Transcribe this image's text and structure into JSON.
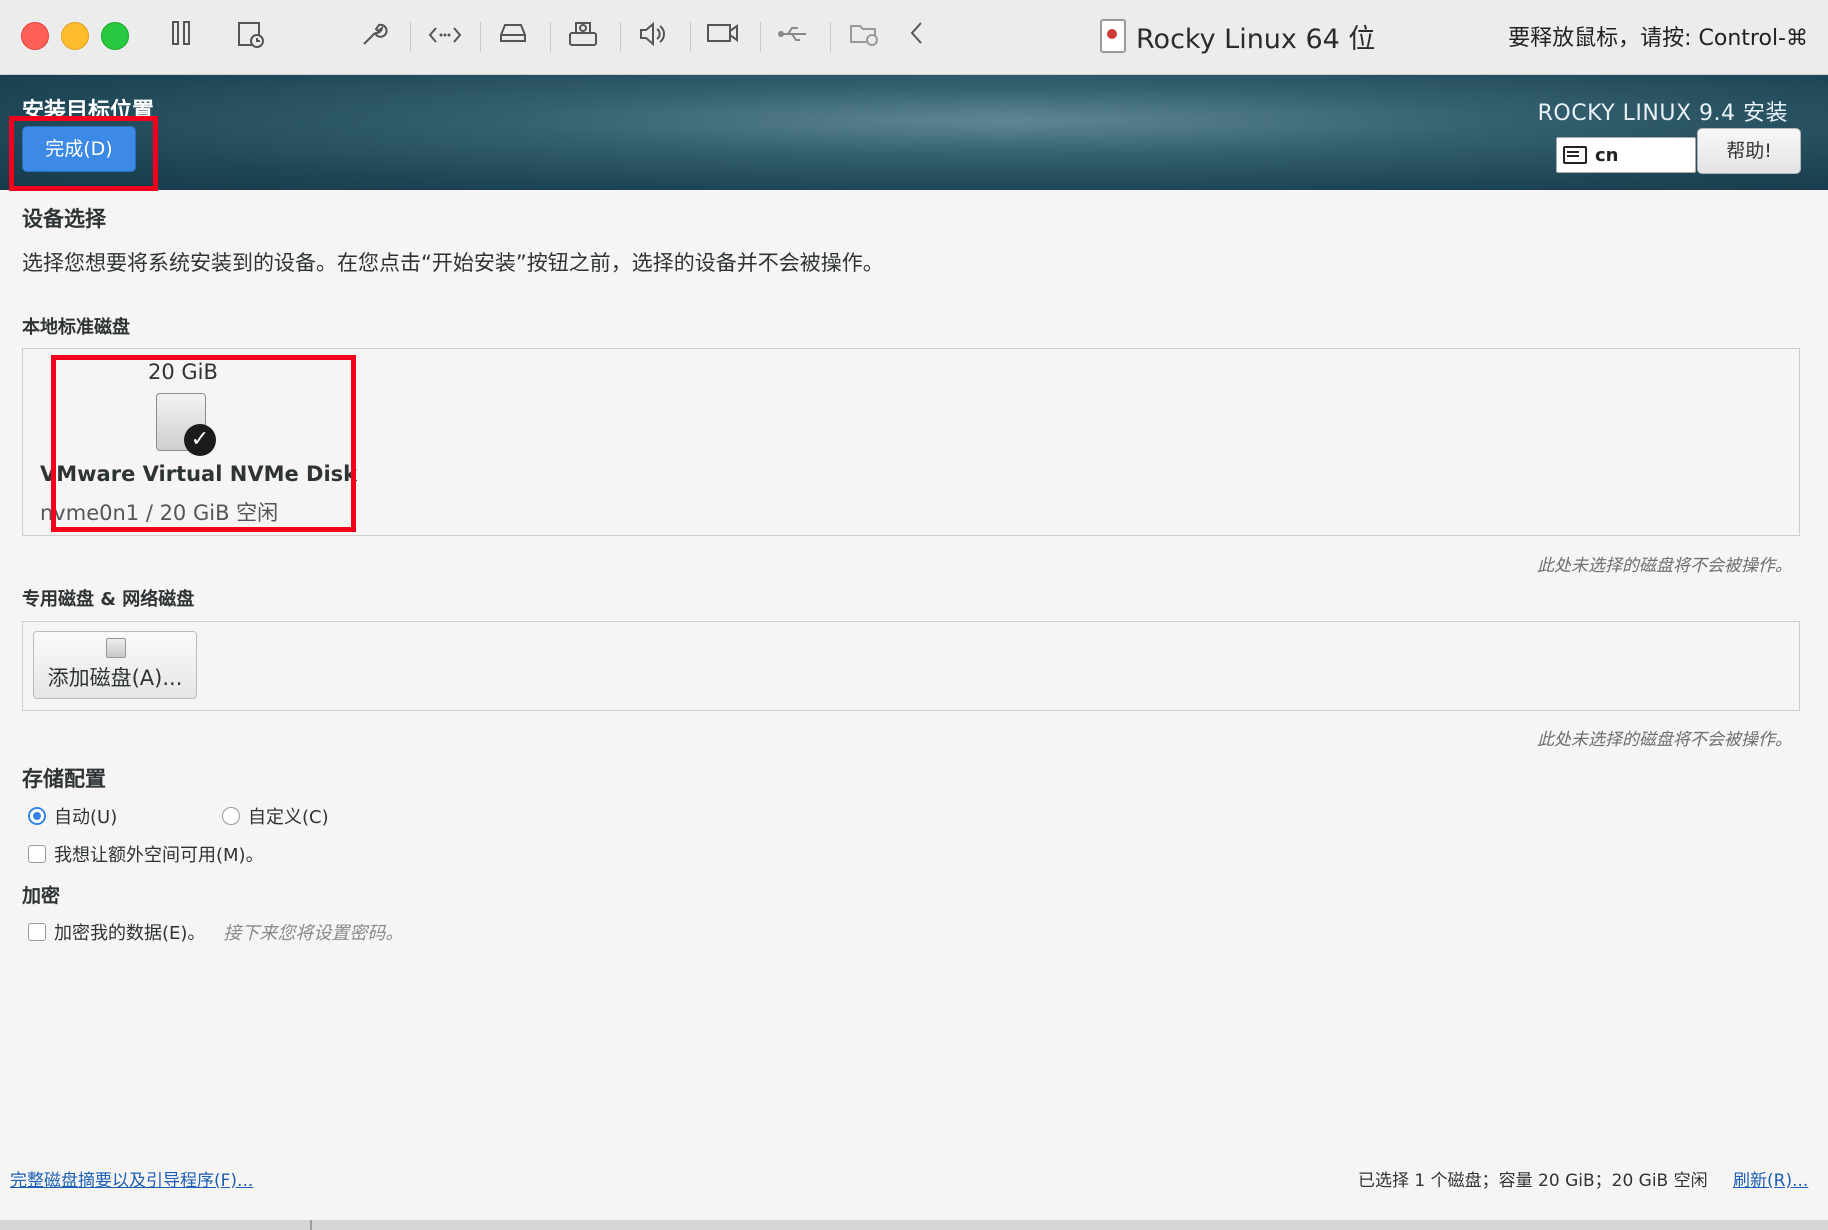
{
  "window": {
    "title": "Rocky Linux 64 位",
    "release_hint": "要释放鼠标，请按: Control-⌘"
  },
  "toolbar": {
    "icons": [
      "pause-icon",
      "snapshot-icon",
      "settings-wrench-icon",
      "code-icon",
      "disk-drive-icon",
      "printer-icon",
      "volume-icon",
      "camera-icon",
      "usb-icon",
      "shared-folder-icon",
      "collapse-chevron-icon"
    ]
  },
  "header": {
    "page_title": "安装目标位置",
    "done_label": "完成(D)",
    "product": "ROCKY LINUX 9.4 安装",
    "keyboard_layout": "cn",
    "help_label": "帮助!"
  },
  "device_selection": {
    "title": "设备选择",
    "description": "选择您想要将系统安装到的设备。在您点击“开始安装”按钮之前，选择的设备并不会被操作。",
    "local_disks_title": "本地标准磁盘",
    "disk": {
      "size": "20 GiB",
      "name": "VMware Virtual NVMe Disk",
      "detail": "nvme0n1  /  20 GiB 空闲",
      "selected": true
    },
    "unselected_hint": "此处未选择的磁盘将不会被操作。",
    "special_disks_title": "专用磁盘 & 网络磁盘",
    "add_disk_label": "添加磁盘(A)...",
    "unselected_hint_2": "此处未选择的磁盘将不会被操作。"
  },
  "storage_config": {
    "title": "存储配置",
    "auto_label": "自动(U)",
    "custom_label": "自定义(C)",
    "auto_selected": true,
    "extra_space_label": "我想让额外空间可用(M)。"
  },
  "encryption": {
    "title": "加密",
    "encrypt_label": "加密我的数据(E)。",
    "encrypt_hint": "接下来您将设置密码。"
  },
  "footer": {
    "summary_link": "完整磁盘摘要以及引导程序(F)...",
    "summary_text": "已选择 1 个磁盘；容量 20 GiB；20 GiB 空闲",
    "refresh_link": "刷新(R)..."
  },
  "colors": {
    "accent": "#3c8ae6",
    "highlight_box": "#f0001c",
    "link": "#1a5fb4"
  }
}
